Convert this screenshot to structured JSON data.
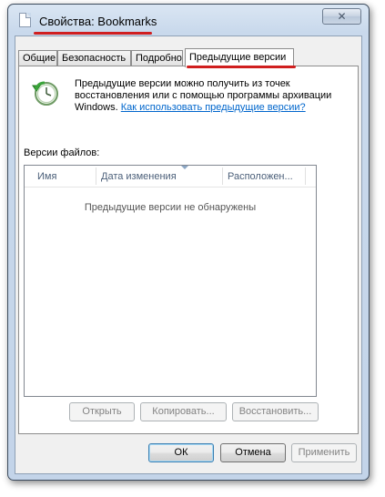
{
  "window": {
    "title": "Свойства: Bookmarks",
    "close_glyph": "✕"
  },
  "tabs": [
    {
      "label": "Общие"
    },
    {
      "label": "Безопасность"
    },
    {
      "label": "Подробно"
    },
    {
      "label": "Предыдущие версии"
    }
  ],
  "panel": {
    "description": "Предыдущие версии можно получить из точек восстановления или с помощью программы архивации Windows.",
    "link_text": "Как использовать предыдущие версии?",
    "versions_label": "Версии файлов:",
    "columns": [
      "Имя",
      "Дата изменения",
      "Расположен..."
    ],
    "empty_text": "Предыдущие версии не обнаружены",
    "buttons": {
      "open": "Открыть",
      "copy": "Копировать...",
      "restore": "Восстановить..."
    }
  },
  "footer": {
    "ok": "ОК",
    "cancel": "Отмена",
    "apply": "Применить"
  }
}
